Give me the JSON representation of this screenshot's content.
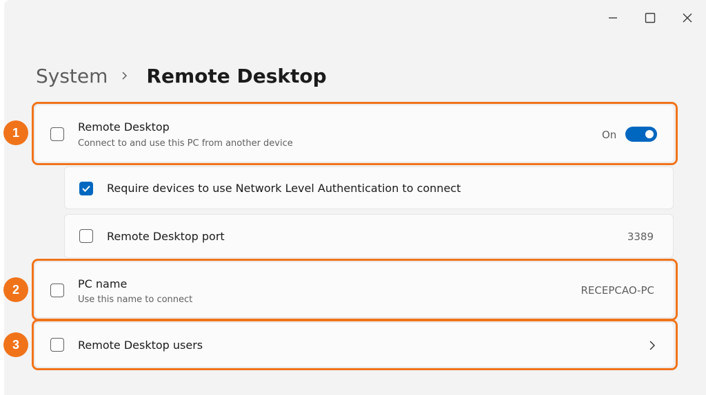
{
  "breadcrumb": {
    "parent": "System",
    "current": "Remote Desktop"
  },
  "settings": {
    "remote_desktop": {
      "title": "Remote Desktop",
      "subtitle": "Connect to and use this PC from another device",
      "toggle_label": "On",
      "toggle_on": true
    },
    "nla": {
      "title": "Require devices to use Network Level Authentication to connect",
      "checked": true
    },
    "port": {
      "title": "Remote Desktop port",
      "value": "3389"
    },
    "pc_name": {
      "title": "PC name",
      "subtitle": "Use this name to connect",
      "value": "RECEPCAO-PC"
    },
    "users": {
      "title": "Remote Desktop users"
    }
  },
  "annotations": [
    "1",
    "2",
    "3"
  ],
  "colors": {
    "accent": "#0067c0",
    "annotation": "#f0731a"
  },
  "icons": {
    "minimize": "minimize-icon",
    "maximize": "maximize-icon",
    "close": "close-icon",
    "breadcrumb_separator": "chevron-right-icon",
    "row_chevron": "chevron-right-icon"
  }
}
